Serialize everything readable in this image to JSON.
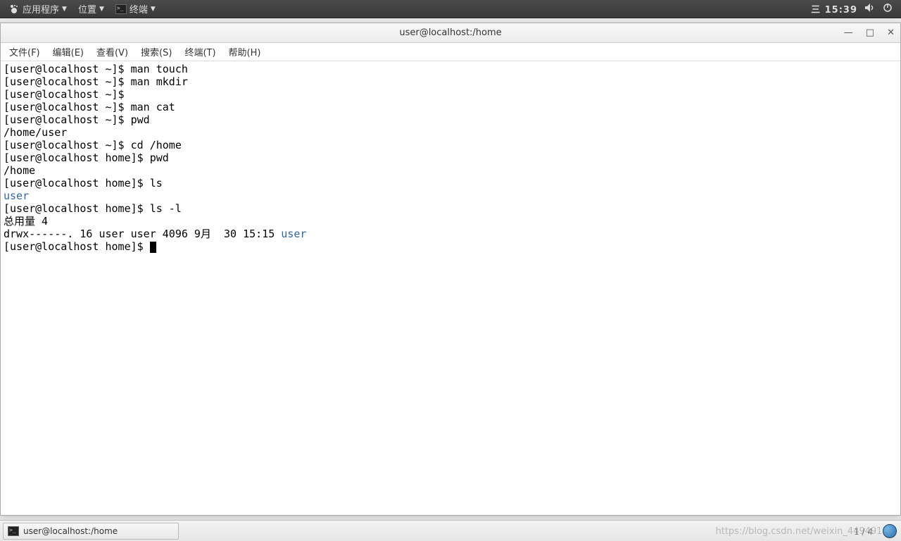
{
  "top_panel": {
    "apps_label": "应用程序",
    "places_label": "位置",
    "terminal_label": "终端",
    "day_label": "三",
    "time": "15:39"
  },
  "window": {
    "title": "user@localhost:/home",
    "menus": [
      "文件(F)",
      "编辑(E)",
      "查看(V)",
      "搜索(S)",
      "终端(T)",
      "帮助(H)"
    ]
  },
  "terminal": {
    "lines": [
      {
        "prompt": "[user@localhost ~]$ ",
        "cmd": "man touch"
      },
      {
        "prompt": "[user@localhost ~]$ ",
        "cmd": "man mkdir"
      },
      {
        "prompt": "[user@localhost ~]$ ",
        "cmd": ""
      },
      {
        "prompt": "[user@localhost ~]$ ",
        "cmd": "man cat"
      },
      {
        "prompt": "[user@localhost ~]$ ",
        "cmd": "pwd"
      },
      {
        "output": "/home/user"
      },
      {
        "prompt": "[user@localhost ~]$ ",
        "cmd": "cd /home"
      },
      {
        "prompt": "[user@localhost home]$ ",
        "cmd": "pwd"
      },
      {
        "output": "/home"
      },
      {
        "prompt": "[user@localhost home]$ ",
        "cmd": "ls"
      },
      {
        "dir_output": "user"
      },
      {
        "prompt": "[user@localhost home]$ ",
        "cmd": "ls -l"
      },
      {
        "output": "总用量 4"
      },
      {
        "ls_line_prefix": "drwx------. 16 user user 4096 9月  30 15:15 ",
        "ls_dir": "user"
      },
      {
        "prompt": "[user@localhost home]$ ",
        "cursor": true
      }
    ]
  },
  "taskbar": {
    "task_label": "user@localhost:/home"
  },
  "watermark": "https://blog.csdn.net/weixin_44949135",
  "page_indicator": "1 / 4"
}
